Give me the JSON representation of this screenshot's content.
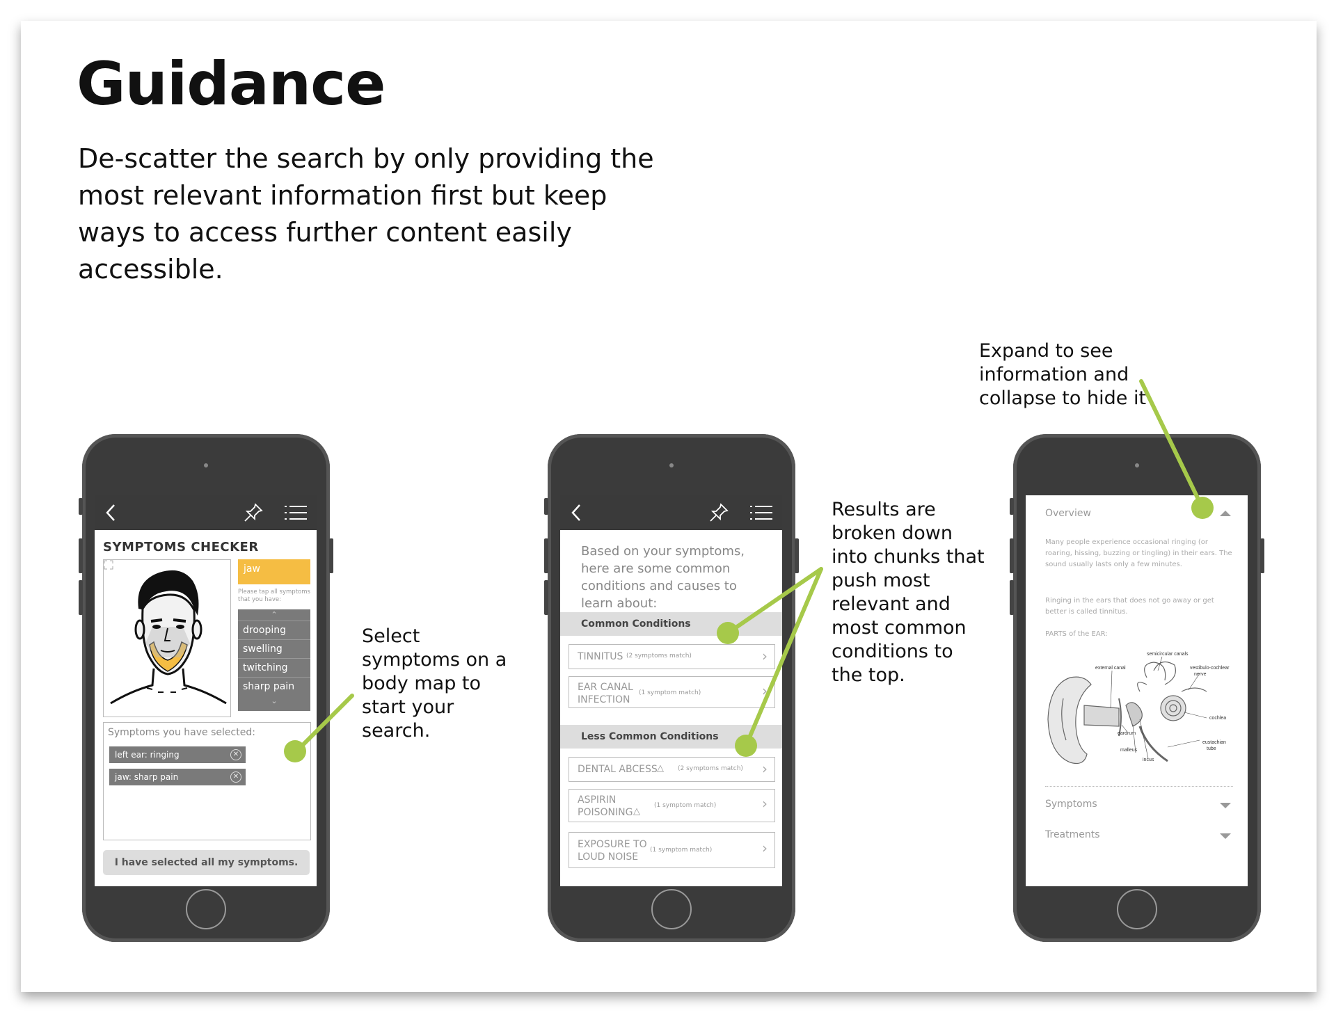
{
  "page": {
    "title": "Guidance",
    "subtitle": "De-scatter the search by only providing the most relevant information first but keep ways to access further content easily accessible."
  },
  "annotations": {
    "symptom_map": "Select symptoms on a body map to start your search.",
    "results": "Results are broken down into chunks that push most relevant and most common conditions to the top.",
    "expand": "Expand to see information and collapse to hide it"
  },
  "colors": {
    "accent_green": "#a6c94a",
    "accent_yellow": "#f5bd43",
    "phone_body": "#3b3b3b"
  },
  "phone1": {
    "nav_icons": [
      "back-icon",
      "pin-icon",
      "menu-icon"
    ],
    "title": "SYMPTOMS CHECKER",
    "selected_area": "jaw",
    "hint": "Please tap all symptoms that you have:",
    "symptoms": [
      "drooping",
      "swelling",
      "twitching",
      "sharp pain"
    ],
    "selected_label": "Symptoms you have selected:",
    "chips": [
      "left ear: ringing",
      "jaw: sharp pain"
    ],
    "done_button": "I have selected all my symptoms."
  },
  "phone2": {
    "intro": "Based on your symptoms, here are some common conditions and causes to learn about:",
    "common_header": "Common Conditions",
    "common": [
      {
        "name": "TINNITUS",
        "match": "(2 symptoms match)"
      },
      {
        "name_l1": "EAR CANAL",
        "name_l2": "INFECTION",
        "match": "(1 symptom match)"
      }
    ],
    "less_header": "Less Common Conditions",
    "less": [
      {
        "name": "DENTAL ABCESS",
        "match": "(2 symptoms match)"
      },
      {
        "name_l1": "ASPIRIN",
        "name_l2": "POISONING",
        "match": "(1 symptom match)"
      },
      {
        "name_l1": "EXPOSURE TO",
        "name_l2": "LOUD NOISE",
        "match": "(1 symptom match)"
      }
    ]
  },
  "phone3": {
    "overview": "Overview",
    "para1": "Many people experience occasional ringing (or roaring, hissing, buzzing or tingling) in their ears. The sound usually lasts only a few minutes.",
    "para2": "Ringing in the ears that does not go away or get better is called tinnitus.",
    "parts_label": "PARTS of the EAR:",
    "ear_labels": {
      "semicircular": "semicircular canals",
      "external": "external canal",
      "vestibulo1": "vestibulo-cochlear",
      "vestibulo2": "nerve",
      "cochlea": "cochlea",
      "eardrum": "eardrum",
      "eustachian1": "eustachian",
      "eustachian2": "tube",
      "malleus": "malleus",
      "incus": "incus"
    },
    "symptoms": "Symptoms",
    "treatments": "Treatments"
  }
}
